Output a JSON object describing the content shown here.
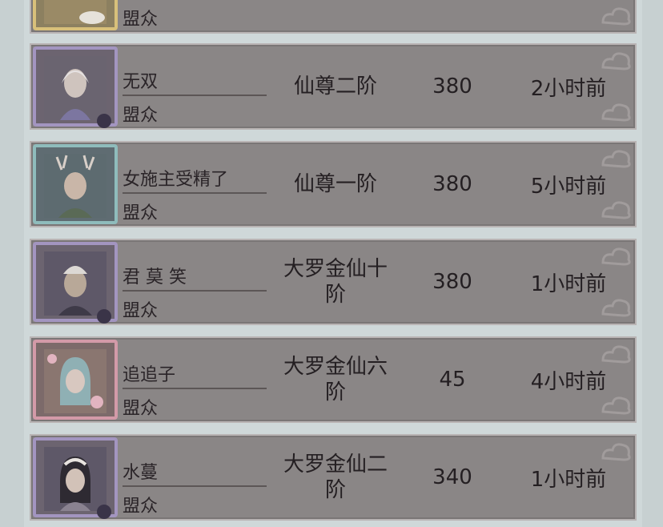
{
  "members": [
    {
      "name": "",
      "role": "盟众",
      "rank": "",
      "score": "",
      "time": "",
      "frame": "gold"
    },
    {
      "name": "无双",
      "role": "盟众",
      "rank": "仙尊二阶",
      "score": "380",
      "time": "2小时前",
      "frame": "purple"
    },
    {
      "name": "女施主受精了",
      "role": "盟众",
      "rank": "仙尊一阶",
      "score": "380",
      "time": "5小时前",
      "frame": "teal"
    },
    {
      "name": "君 莫 笑",
      "role": "盟众",
      "rank": "大罗金仙十阶",
      "score": "380",
      "time": "1小时前",
      "frame": "purple"
    },
    {
      "name": "追追子",
      "role": "盟众",
      "rank": "大罗金仙六阶",
      "score": "45",
      "time": "4小时前",
      "frame": "pink"
    },
    {
      "name": "水蔓",
      "role": "盟众",
      "rank": "大罗金仙二阶",
      "score": "340",
      "time": "1小时前",
      "frame": "purple"
    }
  ]
}
